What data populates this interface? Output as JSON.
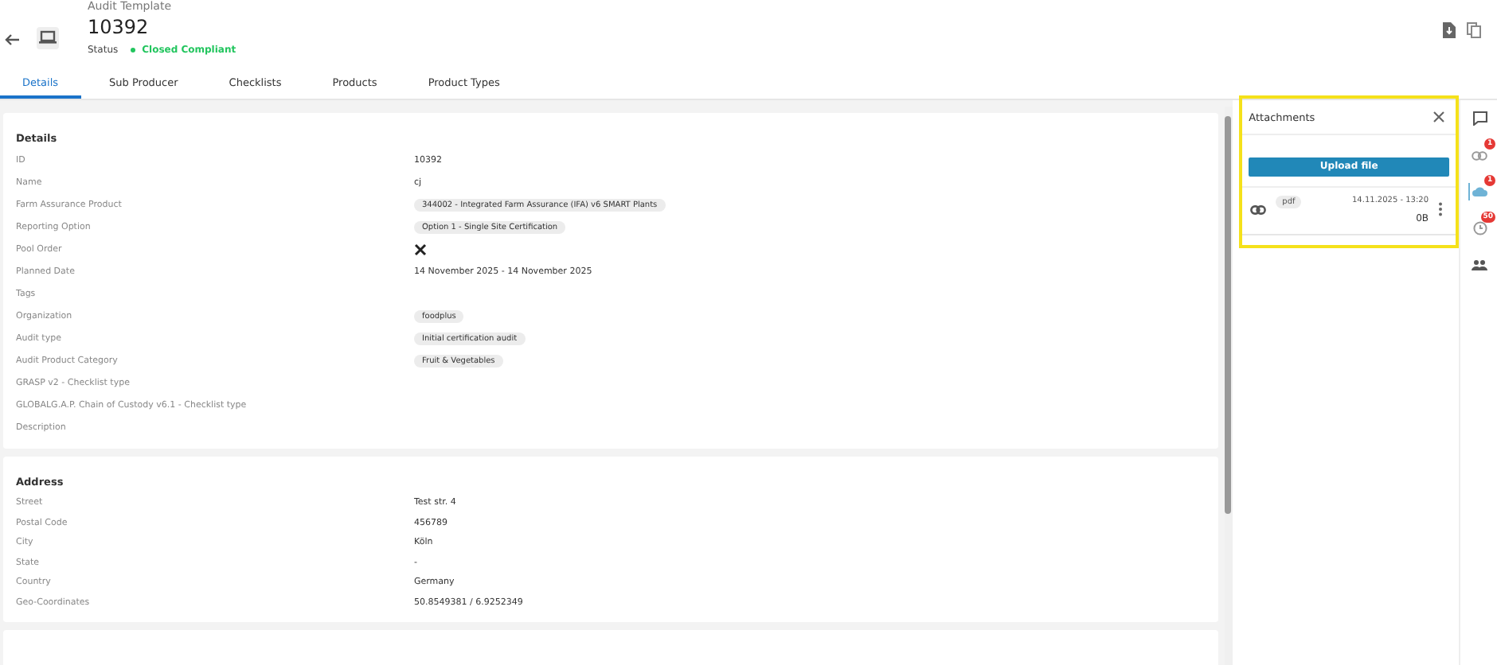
{
  "header": {
    "subtitle": "Audit Template",
    "title": "10392",
    "status_label": "Status",
    "status": {
      "text": "Closed Compliant",
      "color": "#22c55e"
    }
  },
  "tabs": [
    {
      "label": "Details",
      "selected": true
    },
    {
      "label": "Sub Producer",
      "selected": false
    },
    {
      "label": "Checklists",
      "selected": false
    },
    {
      "label": "Products",
      "selected": false
    },
    {
      "label": "Product Types",
      "selected": false
    }
  ],
  "sections": [
    {
      "title": "Details",
      "rows": [
        {
          "label": "ID",
          "kind": "text",
          "value": "10392"
        },
        {
          "label": "Name",
          "kind": "text",
          "value": "cj"
        },
        {
          "label": "Farm Assurance Product",
          "kind": "chip",
          "value": "344002 - Integrated Farm Assurance (IFA) v6 SMART Plants"
        },
        {
          "label": "Reporting Option",
          "kind": "chip",
          "value": "Option 1 - Single Site Certification"
        },
        {
          "label": "Pool Order",
          "kind": "bool",
          "checked": false
        },
        {
          "label": "Planned Date",
          "kind": "text",
          "value": "14 November 2025 - 14 November 2025"
        },
        {
          "label": "Tags",
          "kind": "empty"
        },
        {
          "label": "Organization",
          "kind": "chip",
          "value": "foodplus"
        },
        {
          "label": "Audit type",
          "kind": "chip",
          "value": "Initial certification audit"
        },
        {
          "label": "Audit Product Category",
          "kind": "chip",
          "value": "Fruit & Vegetables"
        },
        {
          "label": "GRASP v2 - Checklist type",
          "kind": "empty"
        },
        {
          "label": "GLOBALG.A.P. Chain of Custody v6.1 - Checklist type",
          "kind": "empty"
        },
        {
          "label": "Description",
          "kind": "empty"
        }
      ]
    },
    {
      "title": "Address",
      "rows": [
        {
          "label": "Street",
          "kind": "text",
          "value": "Test str. 4"
        },
        {
          "label": "Postal Code",
          "kind": "text",
          "value": "456789"
        },
        {
          "label": "City",
          "kind": "text",
          "value": "Köln"
        },
        {
          "label": "State",
          "kind": "text",
          "value": "-"
        },
        {
          "label": "Country",
          "kind": "text",
          "value": "Germany"
        },
        {
          "label": "Geo-Coordinates",
          "kind": "text",
          "value": "50.8549381 / 6.9252349"
        }
      ]
    }
  ],
  "attachments": {
    "title": "Attachments",
    "upload_button": "Upload file",
    "files": [
      {
        "type": "pdf",
        "date": "14.11.2025 - 13:20",
        "size": "0B"
      }
    ]
  },
  "rail": [
    {
      "kind": "comment"
    },
    {
      "kind": "link",
      "badge": "1",
      "selected": false
    },
    {
      "kind": "clip",
      "badge": "1",
      "selected": true
    },
    {
      "kind": "history",
      "badge": "50",
      "selected": false
    },
    {
      "kind": "people"
    }
  ]
}
